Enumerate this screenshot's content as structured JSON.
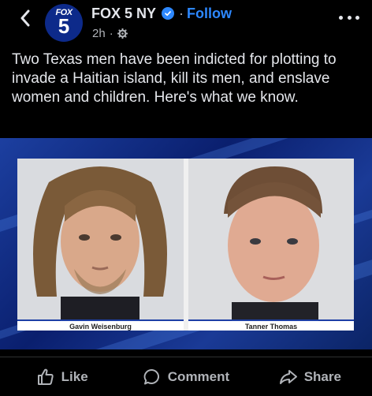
{
  "header": {
    "back_icon": "chevron-left-icon",
    "logo": {
      "top": "FOX",
      "number": "5"
    },
    "page_name": "FOX 5 NY",
    "separator": "·",
    "follow_label": "Follow",
    "time": "2h",
    "meta_separator": "·",
    "privacy_icon": "gear-icon",
    "more_icon": "more-horizontal-icon"
  },
  "post": {
    "text": "Two Texas men have been indicted for plotting to invade a Haitian island, kill its men, and enslave women and children. Here's what we know."
  },
  "media": {
    "left_caption": "Gavin Weisenburg",
    "right_caption": "Tanner Thomas"
  },
  "actions": [
    {
      "label": "Like",
      "icon": "thumbs-up-icon"
    },
    {
      "label": "Comment",
      "icon": "comment-icon"
    },
    {
      "label": "Share",
      "icon": "share-icon"
    }
  ],
  "colors": {
    "background": "#000000",
    "accent": "#2d88ff",
    "text": "#e4e6eb",
    "muted": "#b0b3b8",
    "brand_blue": "#0d2a8a"
  }
}
